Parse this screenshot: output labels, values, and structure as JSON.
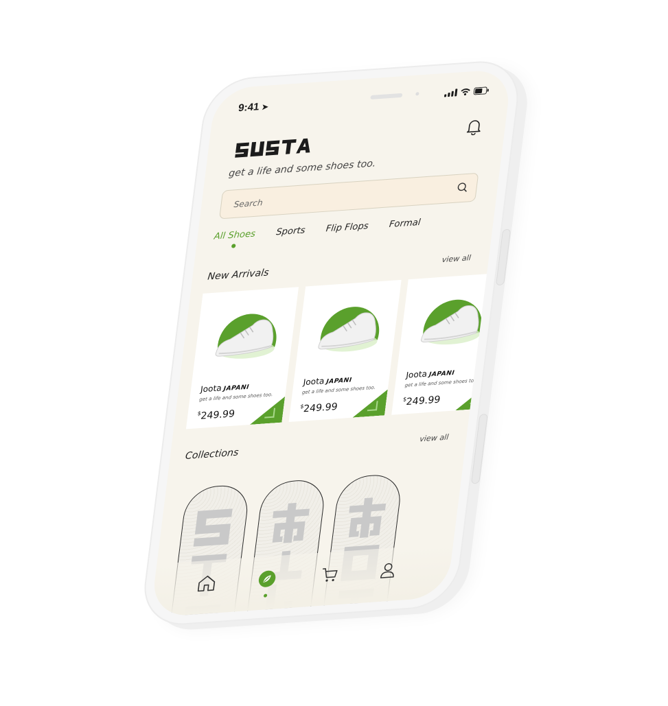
{
  "status": {
    "time": "9:41"
  },
  "brand": {
    "name": "SUSTA",
    "tagline": "get a life and some shoes too."
  },
  "search": {
    "placeholder": "Search"
  },
  "tabs": [
    {
      "label": "All Shoes",
      "active": true
    },
    {
      "label": "Sports",
      "active": false
    },
    {
      "label": "Flip Flops",
      "active": false
    },
    {
      "label": "Formal",
      "active": false
    }
  ],
  "new_arrivals": {
    "title": "New Arrivals",
    "view_all": "view all",
    "products": [
      {
        "name": "Joota",
        "brand": "JAPANI",
        "subtitle": "get a life and some shoes too.",
        "currency": "$",
        "price": "249.99"
      },
      {
        "name": "Joota",
        "brand": "JAPANI",
        "subtitle": "get a life and some shoes too.",
        "currency": "$",
        "price": "249.99"
      },
      {
        "name": "Joota",
        "brand": "JAPANI",
        "subtitle": "get a life and some shoes too.",
        "currency": "$",
        "price": "249.99"
      }
    ]
  },
  "collections": {
    "title": "Collections",
    "view_all": "view all"
  },
  "nav": [
    "home-icon",
    "explore-icon",
    "cart-icon",
    "profile-icon"
  ],
  "colors": {
    "accent": "#5aa02c",
    "background": "#f7f4ec",
    "card": "#ffffff"
  }
}
